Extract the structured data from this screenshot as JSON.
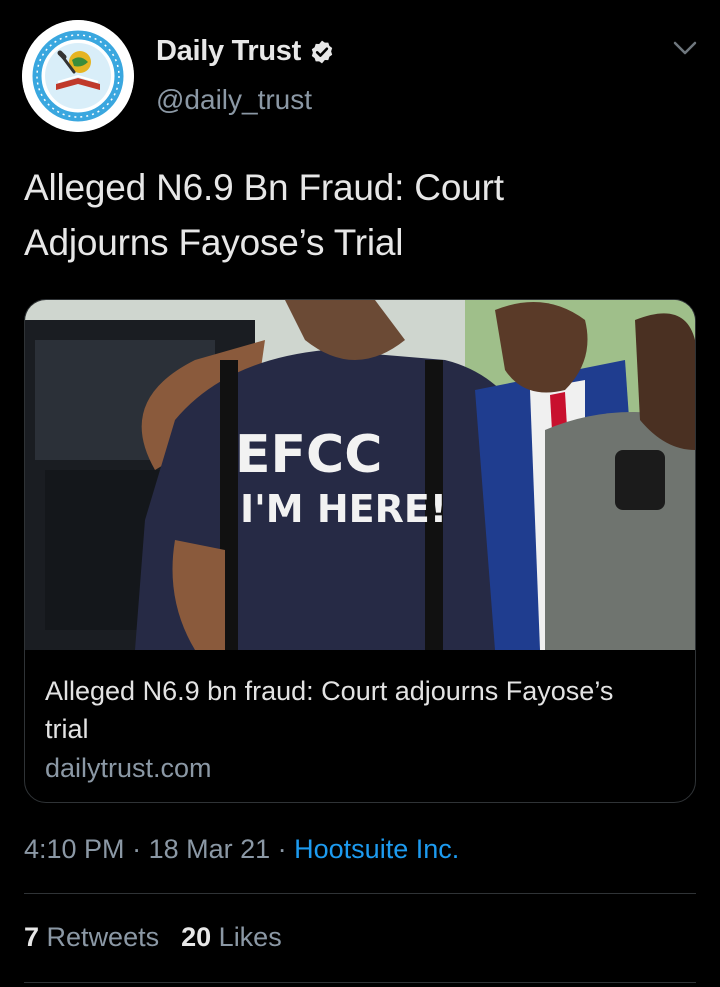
{
  "header": {
    "name": "Daily Trust",
    "handle": "@daily_trust",
    "verified_icon": "verified-badge-icon",
    "more_icon": "chevron-down-icon",
    "avatar_icon": "daily-trust-logo-icon"
  },
  "tweet": {
    "text_line1": "Alleged N6.9 Bn Fraud: Court",
    "text_line2": "Adjourns Fayose’s Trial"
  },
  "card": {
    "image_label": "EFCC I'M HERE!",
    "title_line1": "Alleged N6.9 bn fraud: Court adjourns Fayose’s",
    "title_line2": "trial",
    "domain": "dailytrust.com"
  },
  "meta": {
    "time": "4:10 PM",
    "sep1": " · ",
    "date": "18 Mar 21",
    "sep2": " · ",
    "source": "Hootsuite Inc."
  },
  "stats": {
    "retweets_count": "7",
    "retweets_label": "Retweets",
    "likes_count": "20",
    "likes_label": "Likes"
  },
  "colors": {
    "background": "#000000",
    "text": "#e7e7e7",
    "secondary": "#8b98a5",
    "link": "#1d9bf0",
    "border": "#2f3336"
  }
}
